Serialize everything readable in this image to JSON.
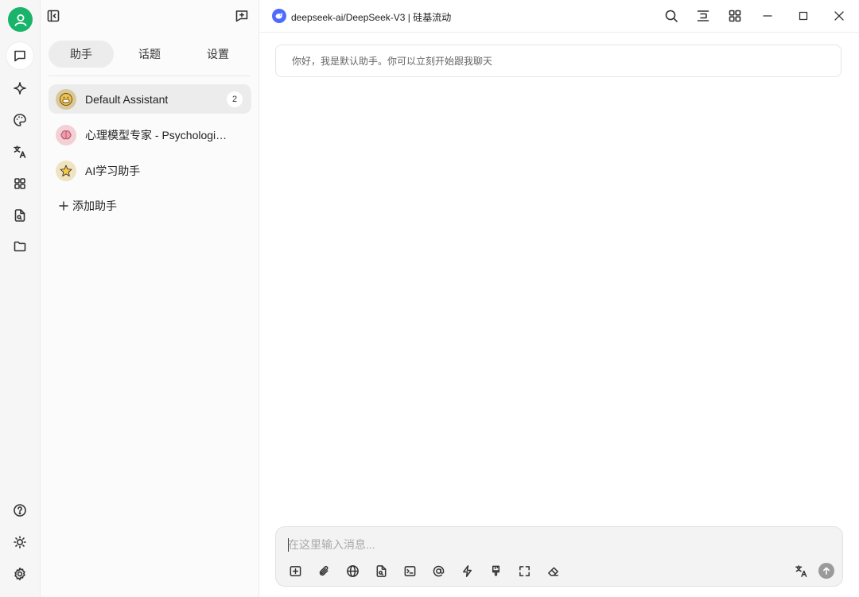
{
  "sidebar": {
    "tabs": [
      {
        "label": "助手",
        "active": true
      },
      {
        "label": "话题",
        "active": false
      },
      {
        "label": "设置",
        "active": false
      }
    ],
    "assistants": [
      {
        "name": "Default Assistant",
        "badge": "2",
        "icon": "grinning-face-icon",
        "active": true
      },
      {
        "name": "心理模型专家 - Psychological Models Expert",
        "icon": "brain-icon",
        "active": false
      },
      {
        "name": "AI学习助手",
        "icon": "star-icon",
        "active": false
      }
    ],
    "add_label": "添加助手"
  },
  "header": {
    "model_title": "deepseek-ai/DeepSeek-V3 | 硅基流动",
    "model_icon": "deepseek-whale-icon"
  },
  "chat": {
    "welcome_message": "你好，我是默认助手。你可以立刻开始跟我聊天"
  },
  "composer": {
    "placeholder": "在这里输入消息...",
    "value": ""
  },
  "colors": {
    "avatar": "#19b46a",
    "model_logo": "#4d6bfe",
    "send_button": "#9a9a9a"
  }
}
